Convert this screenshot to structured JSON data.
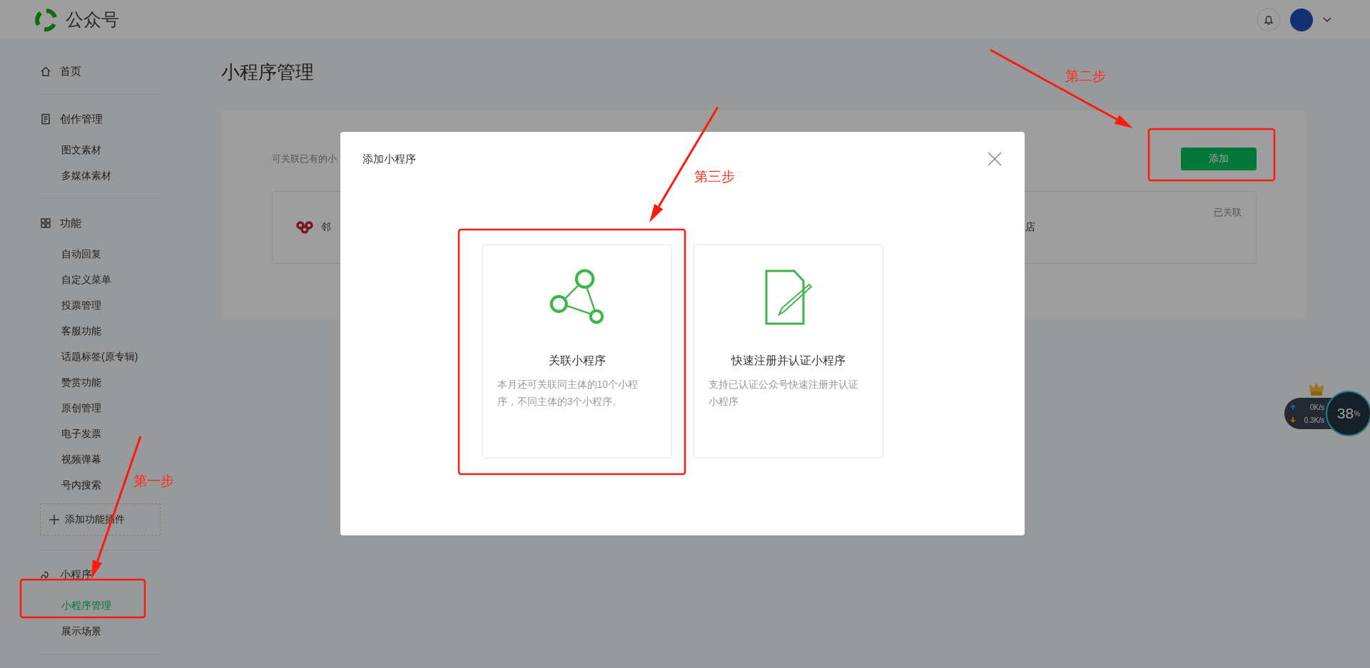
{
  "header": {
    "title": "公众号"
  },
  "sidebar": [
    {
      "kind": "home",
      "title": "首页"
    },
    {
      "kind": "content",
      "title": "创作管理",
      "items": [
        {
          "label": "图文素材",
          "selected": false
        },
        {
          "label": "多媒体素材",
          "selected": false
        }
      ]
    },
    {
      "kind": "features",
      "title": "功能",
      "items": [
        {
          "label": "自动回复",
          "selected": false
        },
        {
          "label": "自定义菜单",
          "selected": false
        },
        {
          "label": "投票管理",
          "selected": false
        },
        {
          "label": "客服功能",
          "selected": false
        },
        {
          "label": "话题标签(原专辑)",
          "selected": false
        },
        {
          "label": "赞赏功能",
          "selected": false
        },
        {
          "label": "原创管理",
          "selected": false
        },
        {
          "label": "电子发票",
          "selected": false
        },
        {
          "label": "视频弹幕",
          "selected": false
        },
        {
          "label": "号内搜索",
          "selected": false
        }
      ],
      "add_button": "添加功能插件"
    },
    {
      "kind": "miniprogram",
      "title": "小程序",
      "items": [
        {
          "label": "小程序管理",
          "selected": true
        },
        {
          "label": "展示场景",
          "selected": false
        }
      ]
    }
  ],
  "page": {
    "title": "小程序管理",
    "description": "可关联已有的小",
    "add_button": "添加",
    "linked": {
      "name": "邻",
      "column_2": "店",
      "status": "已关联"
    }
  },
  "modal": {
    "title": "添加小程序",
    "options": [
      {
        "kind": "link",
        "title": "关联小程序",
        "description": "本月还可关联同主体的10个小程序，不同主体的3个小程序。"
      },
      {
        "kind": "register",
        "title": "快速注册并认证小程序",
        "description": "支持已认证公众号快速注册并认证小程序"
      }
    ]
  },
  "annotations": [
    {
      "text": "第一步"
    },
    {
      "text": "第二步"
    },
    {
      "text": "第三步"
    }
  ],
  "speed_widget": {
    "upload": "0K/s",
    "download": "0.3K/s",
    "percent": "38",
    "percent_sign": "%"
  }
}
